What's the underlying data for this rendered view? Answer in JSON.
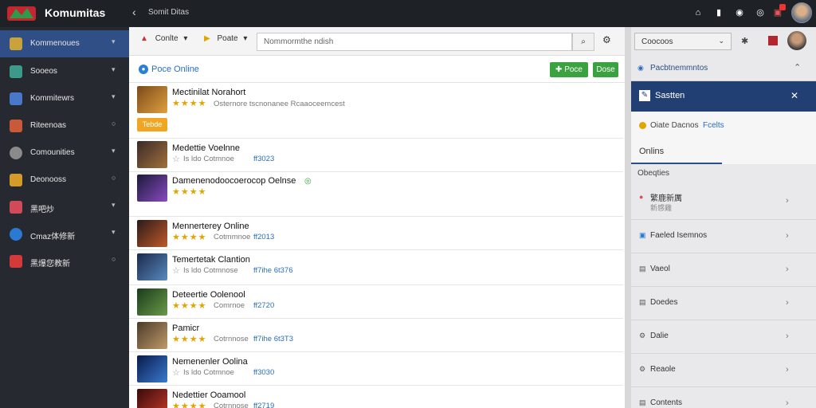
{
  "topbar": {
    "brand": "Komumitas",
    "back_glyph": "‹",
    "breadcrumb": "Somit Ditas",
    "icons": [
      "home-icon",
      "bookmark-icon",
      "chat-icon",
      "info-icon",
      "notification-icon"
    ],
    "notification_count": "9"
  },
  "sidebar": {
    "items": [
      {
        "label": "Kommenoues",
        "chev": "▾",
        "icon_color": "#c9a23a"
      },
      {
        "label": "Sooeos",
        "chev": "▾",
        "icon_color": "#3d9a8a"
      },
      {
        "label": "Kommitewrs",
        "chev": "▾",
        "icon_color": "#4a78c8"
      },
      {
        "label": "Riteenoas",
        "chev": "○",
        "icon_color": "#c85a3a"
      },
      {
        "label": "Comounities",
        "chev": "▾",
        "icon_color": "#8a8a8a"
      },
      {
        "label": "Deonooss",
        "chev": "○",
        "icon_color": "#d49a2a"
      },
      {
        "label": "黑吧炒",
        "chev": "▾",
        "icon_color": "#d04a5a"
      },
      {
        "label": "Cmaz体修新",
        "chev": "▾",
        "icon_color": "#2a7ad4"
      },
      {
        "label": "黑爆您教新",
        "chev": "○",
        "icon_color": "#d43a3a"
      }
    ]
  },
  "toolbar": {
    "filter_label": "Conlte",
    "sort_label": "Poate",
    "search_placeholder": "Nommormthe ndish",
    "search_button_glyph": "⌕",
    "settings_glyph": "⚙"
  },
  "results": {
    "title": "Poce Online",
    "add_button": "Poce",
    "done_button": "Dose"
  },
  "rows": [
    {
      "name": "Mectinilat Norahort",
      "stars": "★★★★",
      "meta": "Osternore tscnonanee Rcaaoceemcest",
      "metaval": "",
      "tag": "Tebde",
      "thumb": "#c77a2a"
    },
    {
      "name": "Medettie Voelnne",
      "stars": "☆",
      "meta": "Is ldo Cotmnoe",
      "metaval": "ff3023",
      "tag": "",
      "thumb": "#8a5a3a"
    },
    {
      "name": "Damenenodoocoerocop  Oelnse",
      "stars": "★★★★",
      "meta": "",
      "metaval": "",
      "tag": "",
      "thumb": "#6a3a8a"
    },
    {
      "name": "Mennerterey Online",
      "stars": "★★★★",
      "meta": "Cotmmnoe",
      "metaval": "ff2013",
      "tag": "",
      "thumb": "#a04a2a"
    },
    {
      "name": "Temertetak Clantion",
      "stars": "☆",
      "meta": "Is ldo Cotmnose",
      "metaval": "ff7ihe   6t376",
      "tag": "",
      "thumb": "#3a5a8a"
    },
    {
      "name": "Deteertie Oolenool",
      "stars": "★★★★",
      "meta": "Comrnoe",
      "metaval": "ff2720",
      "tag": "",
      "thumb": "#4a7a3a"
    },
    {
      "name": "Pamicr",
      "stars": "★★★★",
      "meta": "Cotrnnose",
      "metaval": "ff7ihe   6t3T3",
      "tag": "",
      "thumb": "#8a6a4a"
    },
    {
      "name": "Nemenenler Oolina",
      "stars": "☆",
      "meta": "Is ldo Cotmnoe",
      "metaval": "ff3030",
      "tag": "",
      "thumb": "#2a4a9a"
    },
    {
      "name": "Nedettier Ooamool",
      "stars": "★★★★",
      "meta": "Cotrnnose",
      "metaval": "ff2719",
      "tag": "",
      "thumb": "#9a2a2a"
    }
  ],
  "rightpanel": {
    "select_label": "Coocoos",
    "section_title": "Pacbtnemmntos",
    "active_item": "Sastten",
    "close_glyph": "✕",
    "status_text": "Oiate Dacnos",
    "status_link": "Fcelts",
    "tab_label": "Onlins",
    "group_title": "Obeqties",
    "list": [
      {
        "label": "繁鹿新厲",
        "sub": "新感雞",
        "icon": "●",
        "icon_color": "#d9534f"
      },
      {
        "label": "Faeled Isemnos",
        "sub": "",
        "icon": "▣",
        "icon_color": "#2a7ad4"
      },
      {
        "label": "Vaeol",
        "sub": "",
        "icon": "▤",
        "icon_color": "#555"
      },
      {
        "label": "Doedes",
        "sub": "",
        "icon": "▤",
        "icon_color": "#555"
      },
      {
        "label": "Dalie",
        "sub": "",
        "icon": "⚙",
        "icon_color": "#555"
      },
      {
        "label": "Reaole",
        "sub": "",
        "icon": "⚙",
        "icon_color": "#555"
      },
      {
        "label": "Contents",
        "sub": "",
        "icon": "▤",
        "icon_color": "#555"
      }
    ]
  }
}
